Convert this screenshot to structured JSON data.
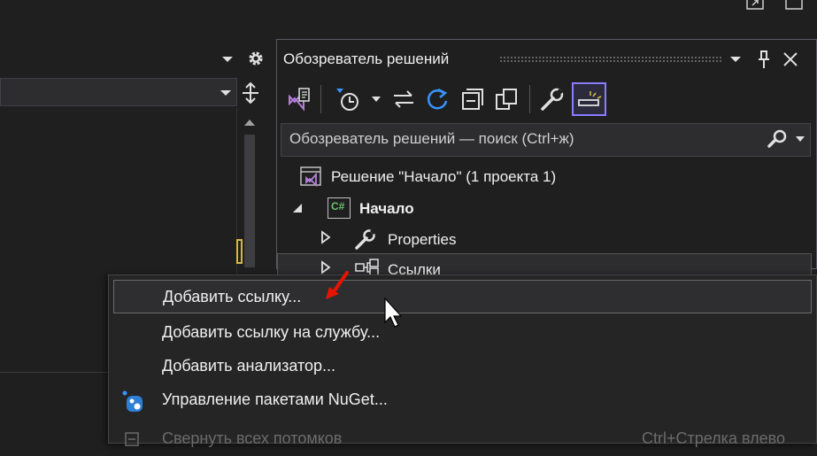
{
  "solution_explorer": {
    "title": "Обозреватель решений",
    "search_placeholder": "Обозреватель решений — поиск (Ctrl+ж)",
    "tree": {
      "solution_label": "Решение \"Начало\"  (1 проекта 1)",
      "project_label": "Начало",
      "project_badge": "C#",
      "properties_label": "Properties",
      "references_label": "Ссылки"
    }
  },
  "context_menu": {
    "items": [
      {
        "label": "Добавить ссылку..."
      },
      {
        "label": "Добавить ссылку на службу..."
      },
      {
        "label": "Добавить анализатор..."
      },
      {
        "label": "Управление пакетами NuGet..."
      },
      {
        "label": "Свернуть всех потомков",
        "shortcut": "Ctrl+Стрелка влево"
      }
    ]
  },
  "colors": {
    "accent": "#8a7cff",
    "vs_purple": "#b180d7",
    "refresh_blue": "#3794ff",
    "arrow_red": "#e51400",
    "csharp_green": "#68c36d"
  }
}
